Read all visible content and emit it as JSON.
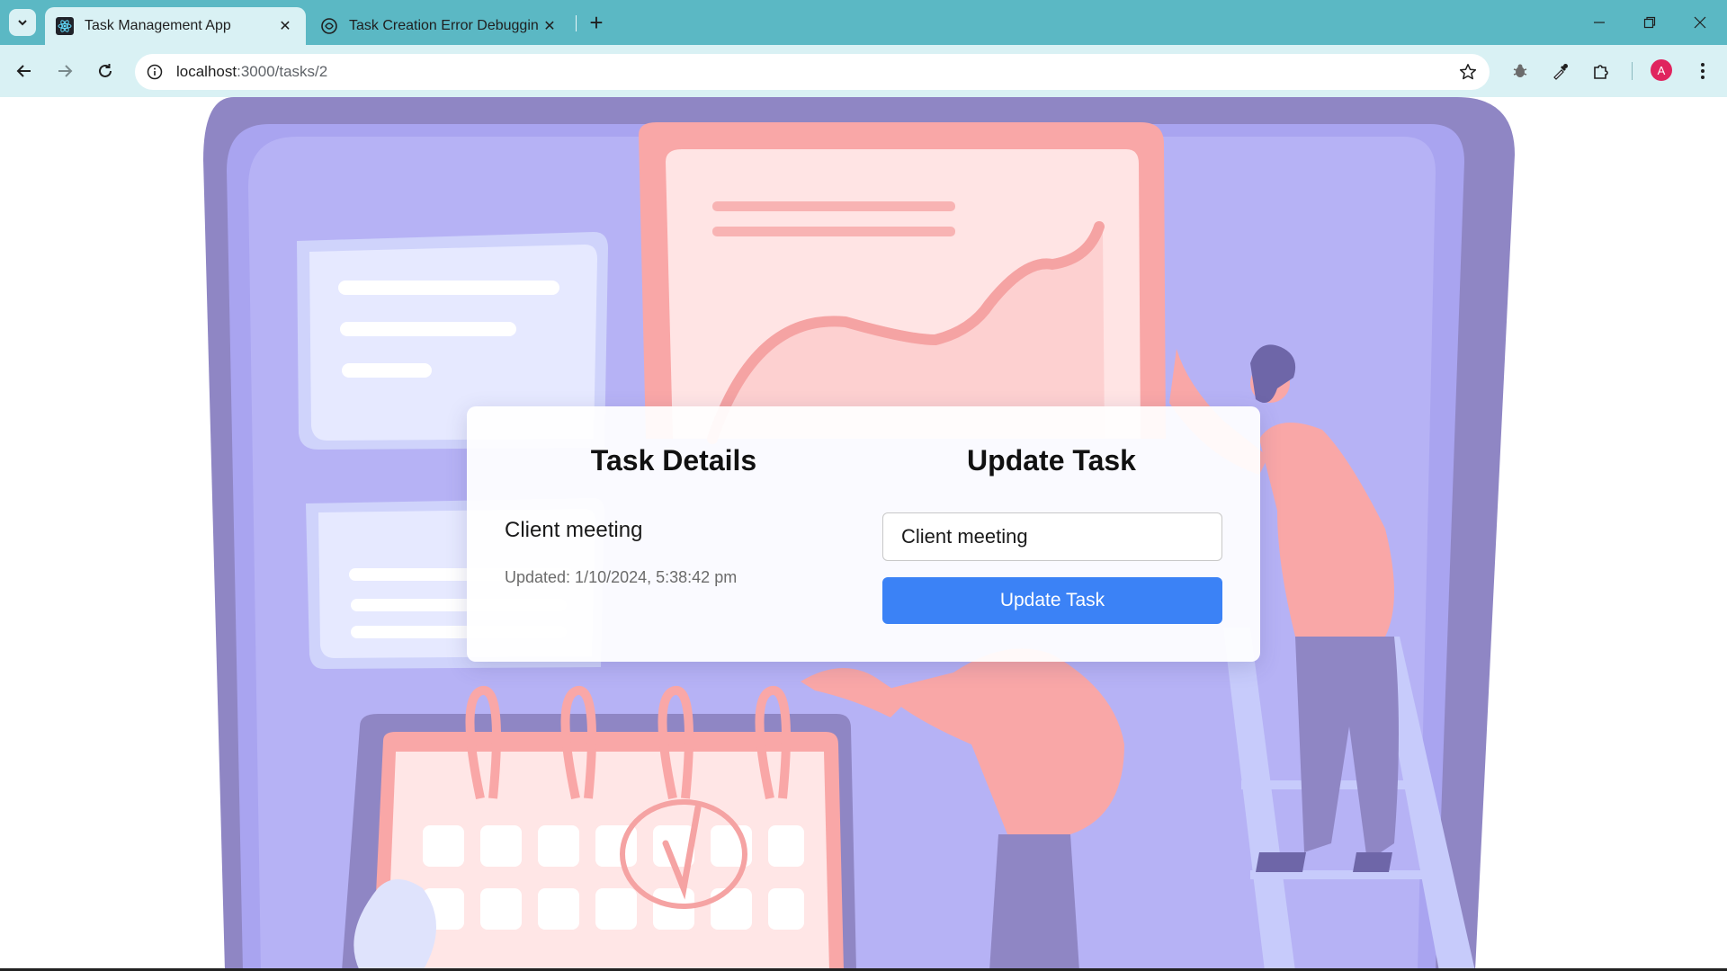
{
  "browser": {
    "tabs": [
      {
        "title": "Task Management App",
        "icon": "react-icon",
        "active": true
      },
      {
        "title": "Task Creation Error Debugging",
        "icon": "chatgpt-icon",
        "active": false
      }
    ],
    "url_host": "localhost",
    "url_path": ":3000/tasks/2",
    "avatar_letter": "A",
    "accent": "#5bb8c4"
  },
  "page": {
    "details_title": "Task Details",
    "update_title": "Update Task",
    "task_name": "Client meeting",
    "updated_text": "Updated: 1/10/2024, 5:38:42 pm",
    "input_value": "Client meeting",
    "button_label": "Update Task",
    "button_color": "#3b82f6"
  }
}
